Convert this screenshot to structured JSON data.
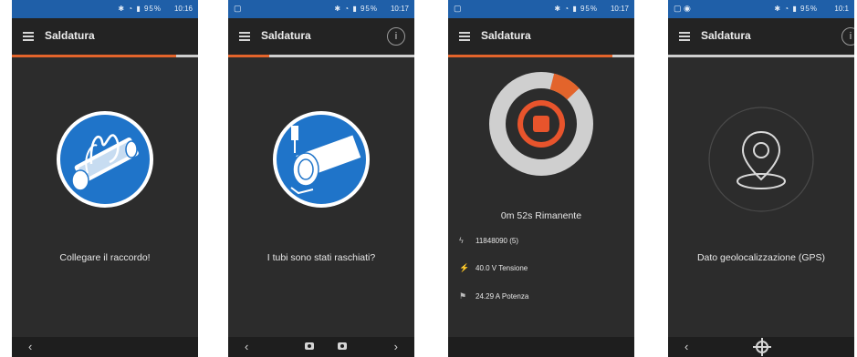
{
  "colors": {
    "status_blue": "#1f5fa8",
    "accent_orange": "#e3642b",
    "icon_blue": "#1f74c9",
    "dark_bg": "#2c2c2c"
  },
  "screens": [
    {
      "status_time": "10:16",
      "status_icons": "✱ ◔ ▮ 95%",
      "title": "Saldatura",
      "progress_fraction": 0.88,
      "caption": "Collegare il raccordo!",
      "nav": {
        "back": "‹"
      }
    },
    {
      "status_time": "10:17",
      "status_icons": "✱ ◔ ▮ 95%",
      "title": "Saldatura",
      "info_label": "i",
      "progress_fraction": 0.22,
      "caption": "I tubi sono stati raschiati?",
      "nav": {
        "back": "‹",
        "next": "›"
      }
    },
    {
      "status_time": "10:17",
      "status_icons": "✱ ◔ ▮ 95%",
      "title": "Saldatura",
      "progress_fraction": 0.88,
      "timer_fraction": 0.09,
      "remaining": "0m 52s Rimanente",
      "stats": [
        {
          "icon": "signal-icon",
          "glyph": "ϟ",
          "text": "11848090 (5)"
        },
        {
          "icon": "voltage-icon",
          "glyph": "⚡",
          "text": "40.0 V Tensione"
        },
        {
          "icon": "flag-icon",
          "glyph": "⚑",
          "text": "24.29 A Potenza"
        }
      ]
    },
    {
      "status_time": "10:1",
      "status_icons": "✱ ◔ ▮ 95%",
      "title": "Saldatura",
      "info_label": "i",
      "progress_fraction": 0.0,
      "caption": "Dato geolocalizzazione (GPS)",
      "nav": {
        "back": "‹"
      }
    }
  ]
}
